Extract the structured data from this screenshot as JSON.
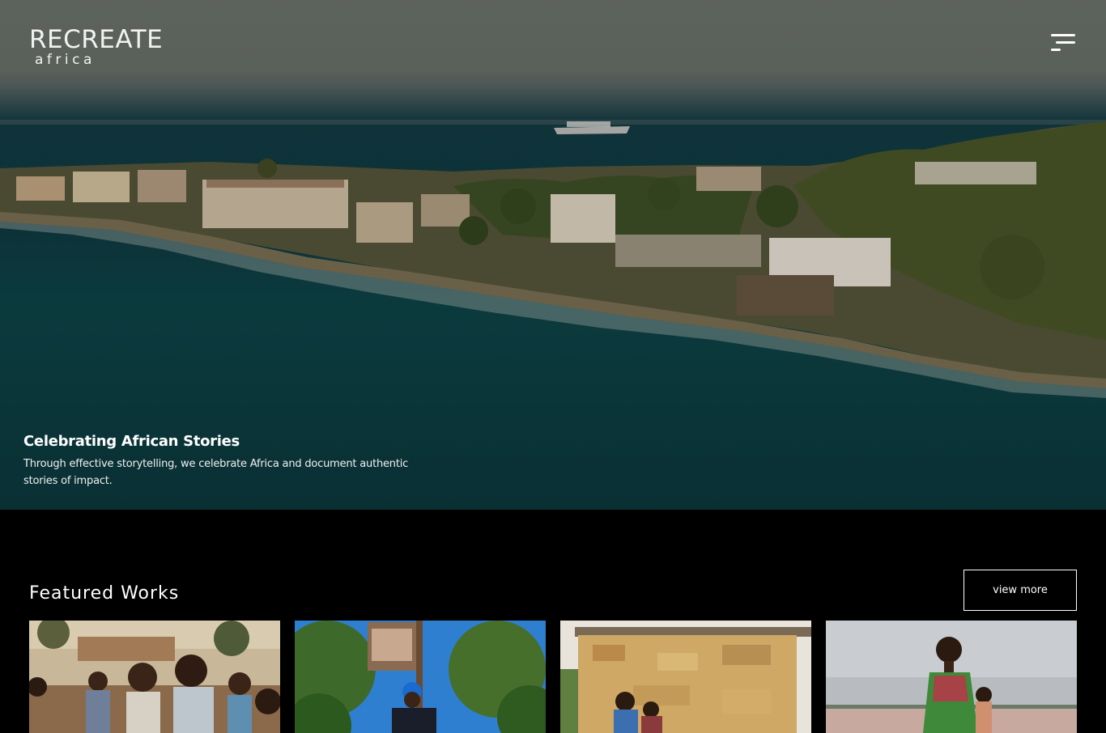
{
  "header": {
    "logo_line1": "RECREATE",
    "logo_line2": "africa",
    "menu_icon": "hamburger-menu-icon"
  },
  "hero": {
    "title": "Celebrating African Stories",
    "subtitle": "Through effective storytelling, we celebrate Africa and document authentic stories of impact."
  },
  "featured": {
    "title": "Featured Works",
    "view_more_label": "view more"
  },
  "colors": {
    "background": "#000000",
    "text": "#ffffff",
    "sky": "#5d625c",
    "sea": "#0c3238"
  }
}
